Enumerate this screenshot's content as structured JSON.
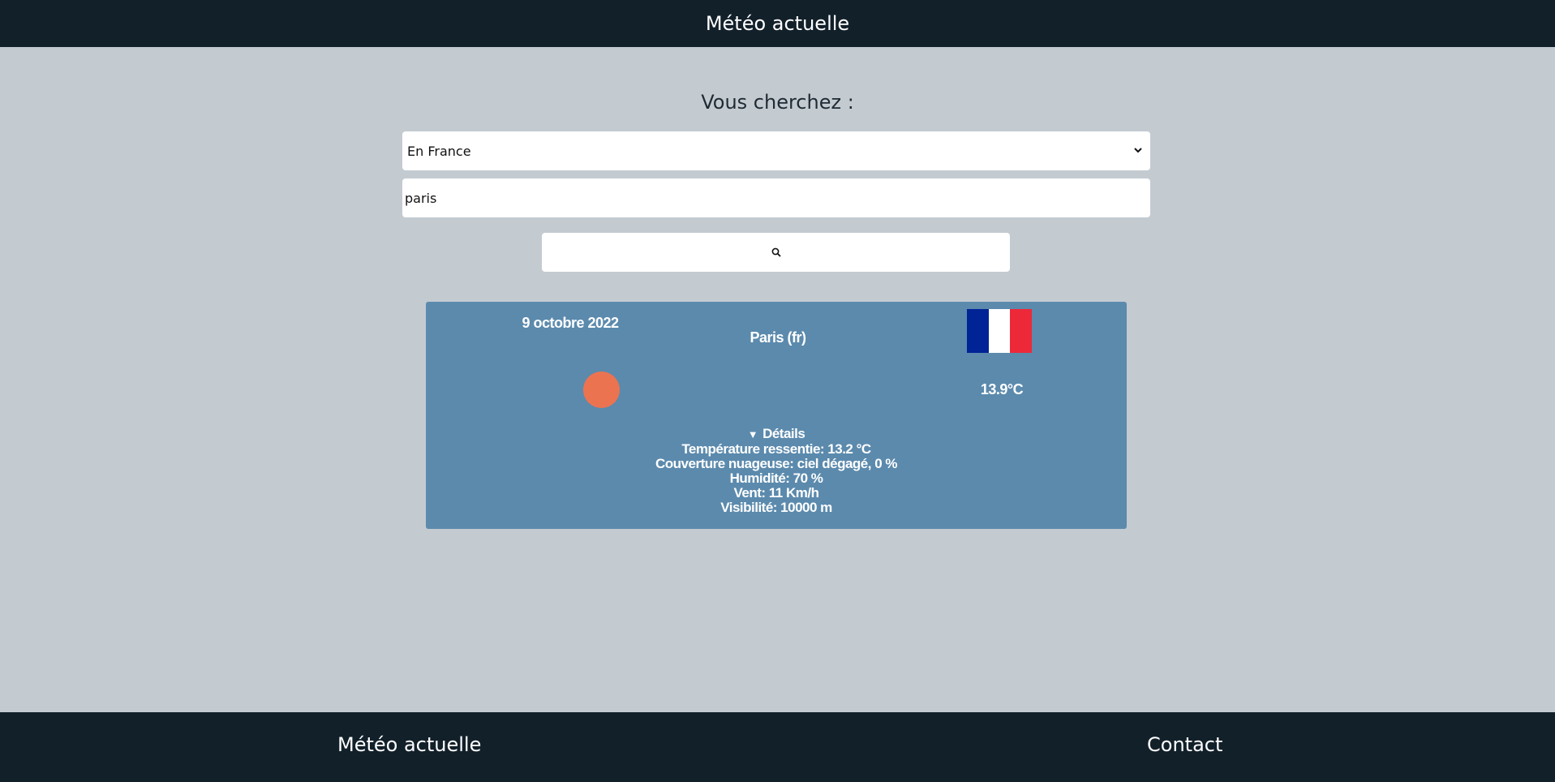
{
  "header": {
    "title": "Météo actuelle"
  },
  "search": {
    "heading": "Vous cherchez :",
    "scope_selected": "En France",
    "city_value": "paris",
    "button_icon": "search-icon"
  },
  "weather": {
    "date": "9 octobre 2022",
    "city": "Paris (fr)",
    "country_flag": "france-flag",
    "flag_colors": [
      "#002395",
      "#ffffff",
      "#ed2939"
    ],
    "condition_icon": "sun-icon",
    "sun_color": "#ec7350",
    "temperature": "13.9°C",
    "details": {
      "summary": "Détails",
      "feels_like": "Température ressentie: 13.2 °C",
      "cloud_cover": "Couverture nuageuse: ciel dégagé, 0 %",
      "humidity": "Humidité: 70 %",
      "wind": "Vent: 11 Km/h",
      "visibility": "Visibilité: 10000 m"
    }
  },
  "footer": {
    "left_link": "Météo actuelle",
    "right_link": "Contact"
  },
  "colors": {
    "header_bg": "#12202a",
    "page_bg": "#c3cbd1",
    "card_bg": "#5b8aad"
  }
}
